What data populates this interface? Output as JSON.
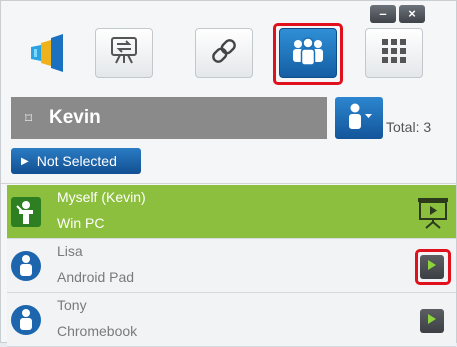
{
  "window": {
    "minimize_label": "–",
    "close_label": "×"
  },
  "toolbar": {
    "buttons": [
      {
        "name": "app-logo",
        "icon": "logo-icon"
      },
      {
        "name": "screen-swap",
        "icon": "screen-swap-icon"
      },
      {
        "name": "link",
        "icon": "link-icon"
      },
      {
        "name": "users",
        "icon": "users-group-icon",
        "active": true
      },
      {
        "name": "grid",
        "icon": "grid-icon"
      }
    ]
  },
  "presenter": {
    "pin_glyph": "⌑",
    "name": "Kevin",
    "total_label": "Total: 3",
    "not_selected_label": "Not Selected"
  },
  "devices": [
    {
      "user": "Myself (Kevin)",
      "device": "Win PC",
      "role": "self",
      "action_icon": "presentation-screen-icon"
    },
    {
      "user": "Lisa",
      "device": "Android Pad",
      "role": "participant",
      "action_icon": "play-icon"
    },
    {
      "user": "Tony",
      "device": "Chromebook",
      "role": "participant",
      "action_icon": "play-icon"
    }
  ],
  "colors": {
    "accent_blue": "#1a6fb8",
    "self_row_green": "#8cbf3d",
    "highlight_red": "#e0101c"
  }
}
